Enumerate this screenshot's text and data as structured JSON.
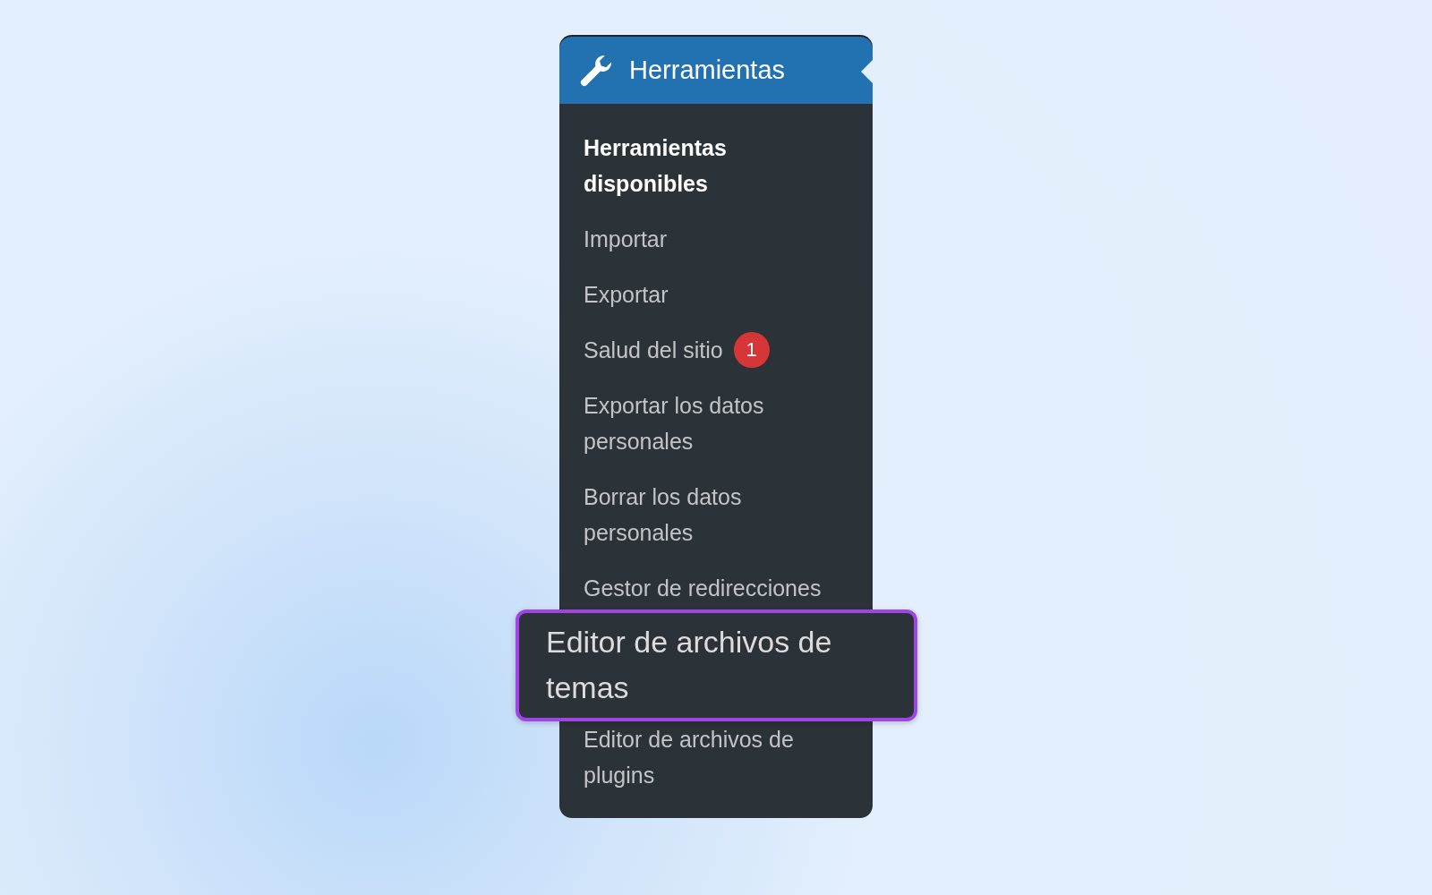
{
  "menu": {
    "title": "Herramientas",
    "selected": true,
    "items": [
      {
        "label": "Herramientas disponibles",
        "selected": true,
        "highlighted": false
      },
      {
        "label": "Importar",
        "selected": false,
        "highlighted": false
      },
      {
        "label": "Exportar",
        "selected": false,
        "highlighted": false
      },
      {
        "label": "Salud del sitio",
        "selected": false,
        "highlighted": false,
        "badge": "1"
      },
      {
        "label": "Exportar los datos personales",
        "selected": false,
        "highlighted": false
      },
      {
        "label": "Borrar los datos personales",
        "selected": false,
        "highlighted": false
      },
      {
        "label": "Gestor de redirecciones",
        "selected": false,
        "highlighted": false
      },
      {
        "label": "Editor de archivos de temas",
        "selected": false,
        "highlighted": true
      },
      {
        "label": "Editor de archivos de plugins",
        "selected": false,
        "highlighted": false
      }
    ]
  }
}
